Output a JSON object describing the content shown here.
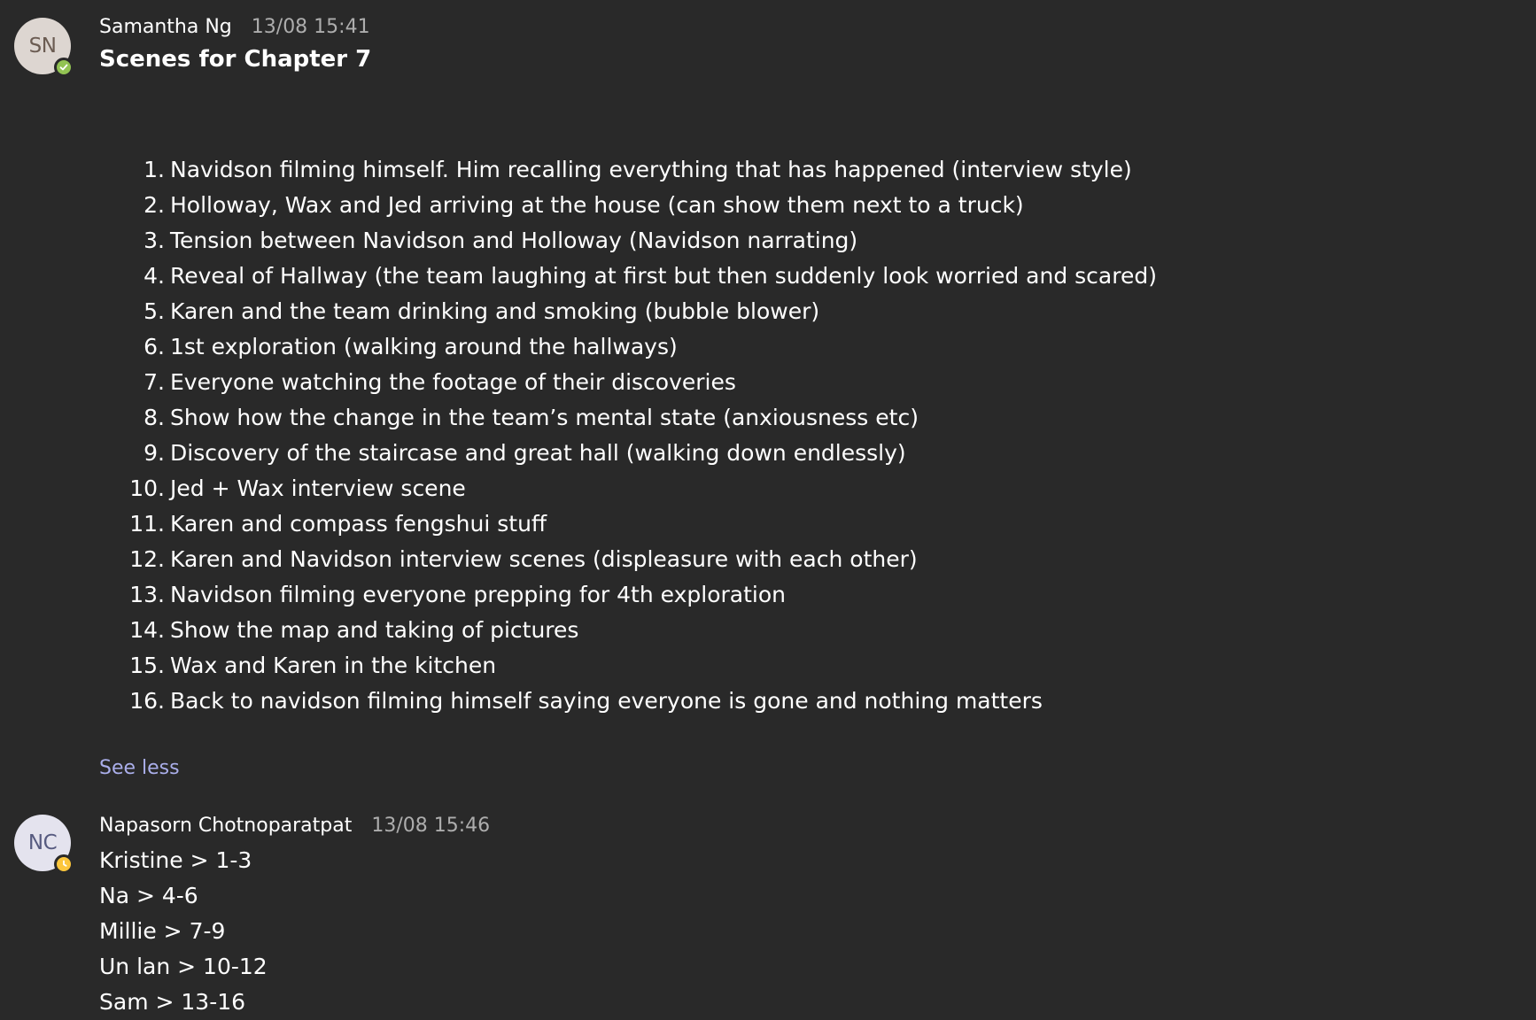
{
  "messages": [
    {
      "initials": "SN",
      "author": "Samantha Ng",
      "timestamp": "13/08 15:41",
      "presence_icon": "check-icon",
      "presence_color": "#92c353",
      "subject": "Scenes for Chapter 7",
      "scenes": [
        {
          "num": "1.",
          "text": "Navidson filming himself. Him recalling everything that has happened (interview style)"
        },
        {
          "num": "2.",
          "text": "Holloway, Wax and Jed arriving at the house (can show them next to a truck)"
        },
        {
          "num": "3.",
          "text": "Tension between Navidson and Holloway (Navidson narrating)"
        },
        {
          "num": "4.",
          "text": "Reveal of Hallway (the team laughing at first but then suddenly look worried and scared)"
        },
        {
          "num": "5.",
          "text": "Karen and the team drinking and smoking (bubble blower)"
        },
        {
          "num": "6.",
          "text": "1st exploration (walking around the hallways)"
        },
        {
          "num": "7.",
          "text": "Everyone watching the footage of their discoveries"
        },
        {
          "num": "8.",
          "text": "Show how the change in the team’s mental state (anxiousness etc)"
        },
        {
          "num": "9.",
          "text": "Discovery of the staircase and great hall (walking down endlessly)"
        },
        {
          "num": "10.",
          "text": "Jed + Wax interview scene"
        },
        {
          "num": "11.",
          "text": "Karen and compass fengshui stuff"
        },
        {
          "num": "12.",
          "text": "Karen and Navidson interview scenes (displeasure with each other)"
        },
        {
          "num": "13.",
          "text": "Navidson filming everyone prepping for 4th exploration"
        },
        {
          "num": "14.",
          "text": "Show the map and taking of pictures"
        },
        {
          "num": "15.",
          "text": "Wax and Karen in the kitchen"
        },
        {
          "num": "16.",
          "text": "Back to navidson filming himself saying everyone is gone and nothing matters"
        }
      ],
      "see_less": "See less"
    },
    {
      "initials": "NC",
      "author": "Napasorn Chotnoparatpat",
      "timestamp": "13/08 15:46",
      "presence_icon": "clock-icon",
      "presence_color": "#fcc63c",
      "lines": [
        "Kristine > 1-3",
        "Na > 4-6",
        "Millie > 7-9",
        "Un lan > 10-12",
        "Sam > 13-16"
      ]
    }
  ]
}
